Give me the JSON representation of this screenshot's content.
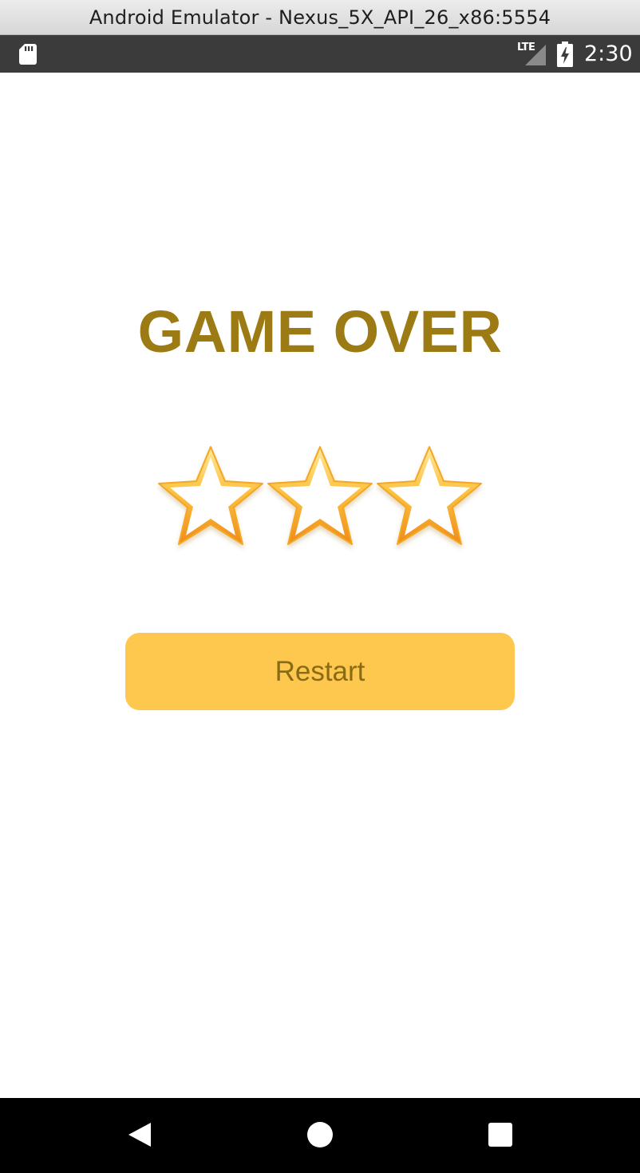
{
  "window": {
    "title": "Android Emulator - Nexus_5X_API_26_x86:5554"
  },
  "status_bar": {
    "left_icon": "sd-card-icon",
    "network_label": "LTE",
    "battery_icon": "battery-charging-icon",
    "time": "2:30"
  },
  "game": {
    "title": "GAME OVER",
    "stars_total": 3,
    "stars_earned": 0,
    "restart_label": "Restart"
  },
  "nav_bar": {
    "buttons": [
      "back-icon",
      "home-icon",
      "recents-icon"
    ]
  },
  "colors": {
    "title": "#9c7a14",
    "button_bg": "#fec74d",
    "button_text": "#8a6a12",
    "star_outline": "#f5a623",
    "status_bar": "#3b3b3b",
    "nav_bar": "#000000"
  }
}
